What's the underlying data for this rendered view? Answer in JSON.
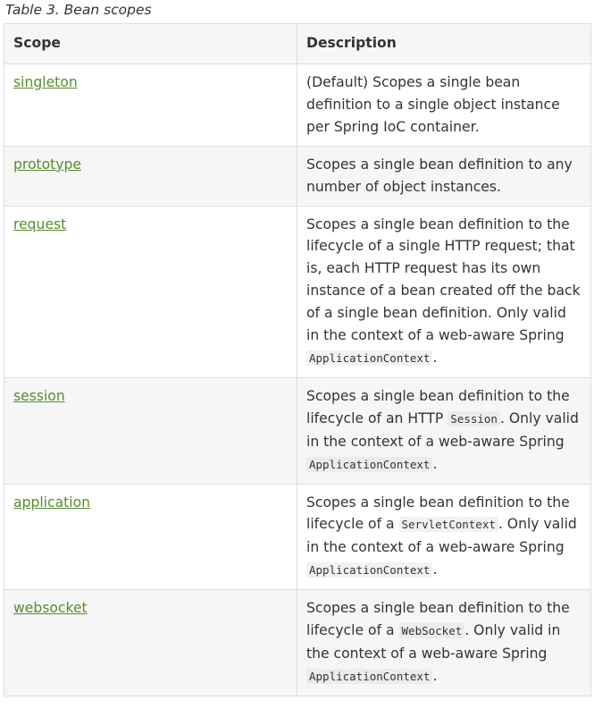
{
  "caption": "Table 3. Bean scopes",
  "columns": [
    "Scope",
    "Description"
  ],
  "rows": [
    {
      "scope": "singleton",
      "description": "(Default) Scopes a single bean definition to a single object instance per Spring IoC container."
    },
    {
      "scope": "prototype",
      "description": "Scopes a single bean definition to any number of object instances."
    },
    {
      "scope": "request",
      "desc_before": "Scopes a single bean definition to the lifecycle of a single HTTP request; that is, each HTTP request has its own instance of a bean created off the back of a single bean definition. Only valid in the context of a web-aware Spring ",
      "desc_code": "ApplicationContext",
      "desc_after": "."
    },
    {
      "scope": "session",
      "desc_before": "Scopes a single bean definition to the lifecycle of an HTTP ",
      "desc_code": "Session",
      "desc_mid": ". Only valid in the context of a web-aware Spring ",
      "desc_code2": "ApplicationContext",
      "desc_after": "."
    },
    {
      "scope": "application",
      "desc_before": "Scopes a single bean definition to the lifecycle of a ",
      "desc_code": "ServletContext",
      "desc_mid": ". Only valid in the context of a web-aware Spring ",
      "desc_code2": "ApplicationContext",
      "desc_after": "."
    },
    {
      "scope": "websocket",
      "desc_before": "Scopes a single bean definition to the lifecycle of a ",
      "desc_code": "WebSocket",
      "desc_mid": ". Only valid in the context of a web-aware Spring ",
      "desc_code2": "ApplicationContext",
      "desc_after": "."
    }
  ],
  "colors": {
    "link": "#548e2e",
    "text": "#333333",
    "border": "#dddddd",
    "stripe": "#f6f6f6"
  }
}
